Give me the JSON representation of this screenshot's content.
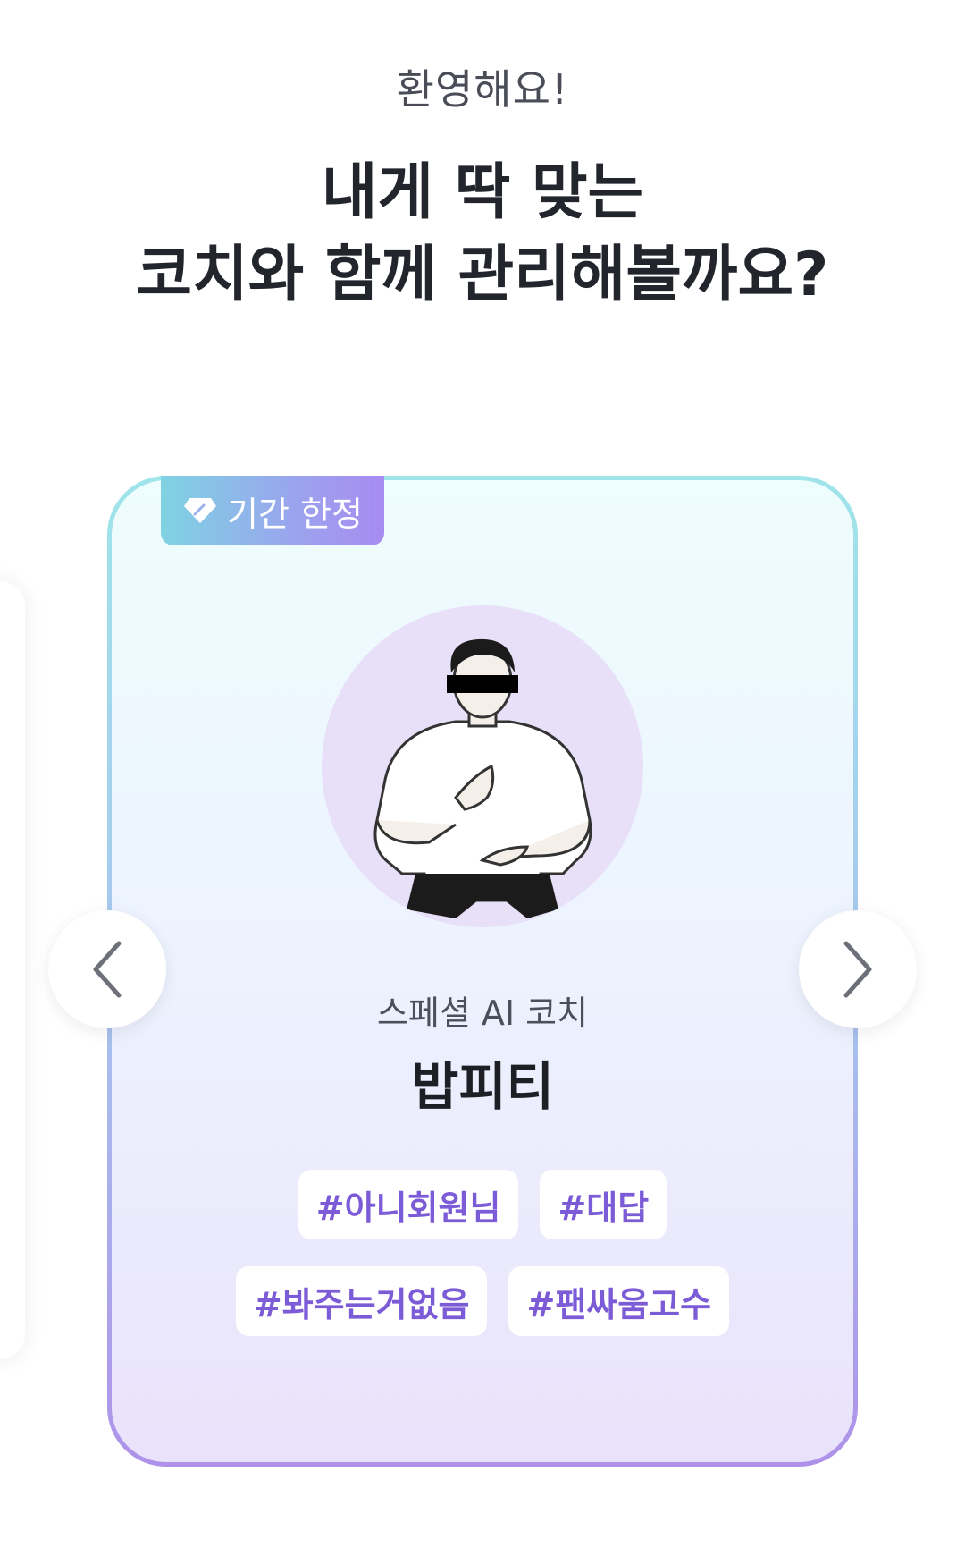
{
  "header": {
    "welcome": "환영해요!",
    "headline_line1": "내게 딱 맞는",
    "headline_line2": "코치와 함께 관리해볼까요?"
  },
  "card": {
    "badge_label": "기간 한정",
    "badge_icon": "diamond-tag-icon",
    "subtitle": "스페셜 AI 코치",
    "name": "밥피티",
    "tags": [
      "#아니회원님",
      "#대답",
      "#봐주는거없음",
      "#팬싸움고수"
    ]
  },
  "navigation": {
    "prev_icon": "chevron-left-icon",
    "next_icon": "chevron-right-icon"
  },
  "colors": {
    "tag_text": "#7b5bd6",
    "card_border_top": "#9fe5ea",
    "card_border_bottom": "#ae92e9",
    "headline": "#23252d"
  }
}
